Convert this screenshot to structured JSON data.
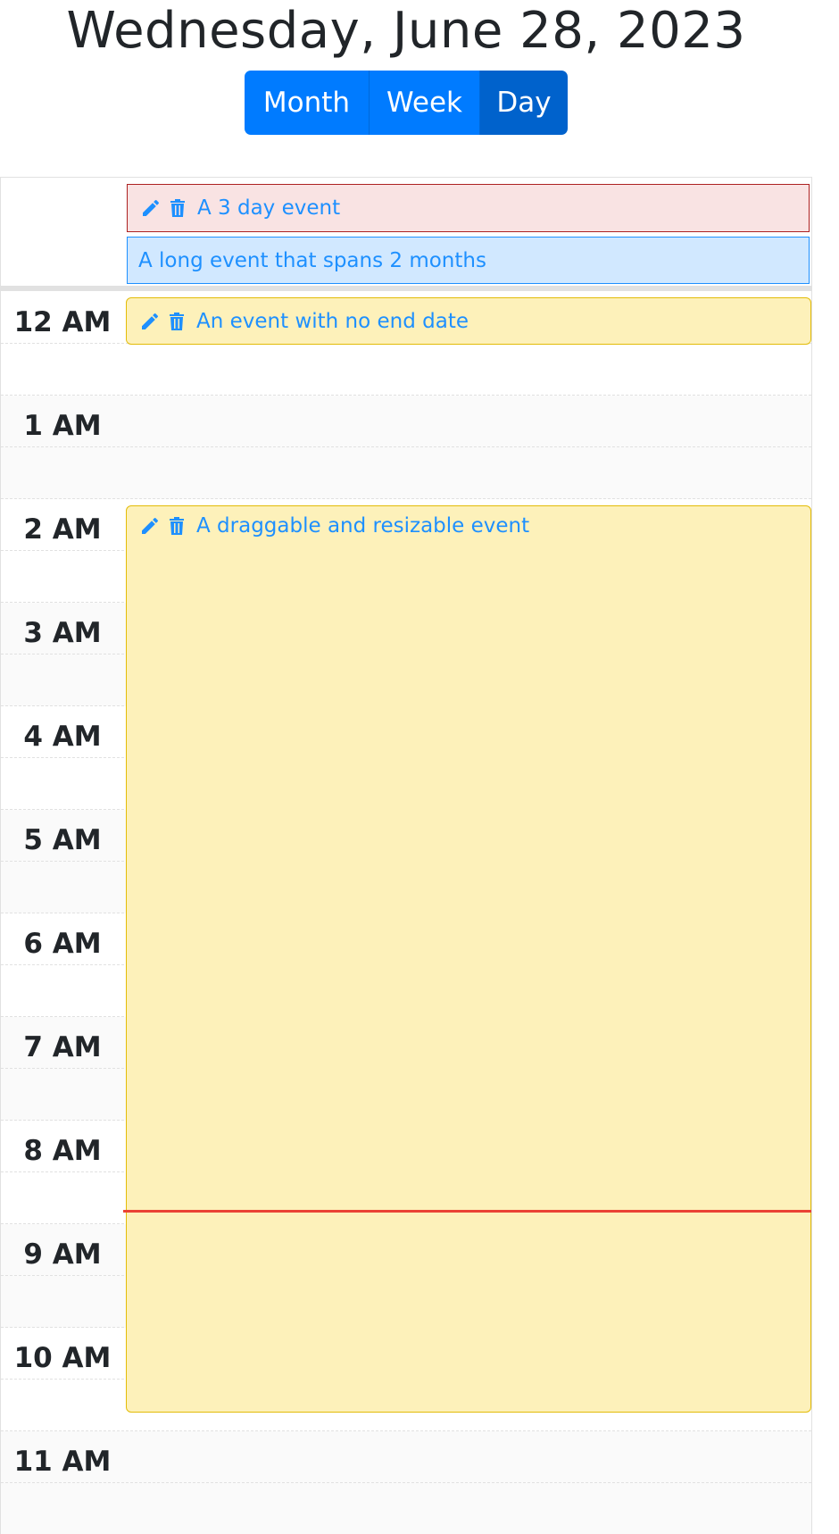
{
  "header": {
    "title": "Wednesday, June 28, 2023"
  },
  "view_switch": {
    "month_label": "Month",
    "week_label": "Week",
    "day_label": "Day",
    "active": "Day"
  },
  "allday_events": [
    {
      "title": "A 3 day event",
      "color": "#ad2121",
      "bg": "#f9e3e3",
      "actions": [
        "pencil-icon",
        "trash-icon"
      ]
    },
    {
      "title": "A long event that spans 2 months",
      "color": "#1e90ff",
      "bg": "#d1e8ff",
      "actions": []
    }
  ],
  "timed_events": [
    {
      "title": "An event with no end date",
      "color": "#e3bc08",
      "bg": "#fdf1ba",
      "actions": [
        "pencil-icon",
        "trash-icon"
      ]
    },
    {
      "title": "A draggable and resizable event",
      "color": "#e3bc08",
      "bg": "#fdf1ba",
      "actions": [
        "pencil-icon",
        "trash-icon"
      ]
    }
  ],
  "hours": [
    "12 AM",
    "1 AM",
    "2 AM",
    "3 AM",
    "4 AM",
    "5 AM",
    "6 AM",
    "7 AM",
    "8 AM",
    "9 AM",
    "10 AM",
    "11 AM"
  ],
  "colors": {
    "accent": "#007bff",
    "active": "#0062cc",
    "current_time": "#ea4334",
    "event_text": "#1e90ff"
  }
}
